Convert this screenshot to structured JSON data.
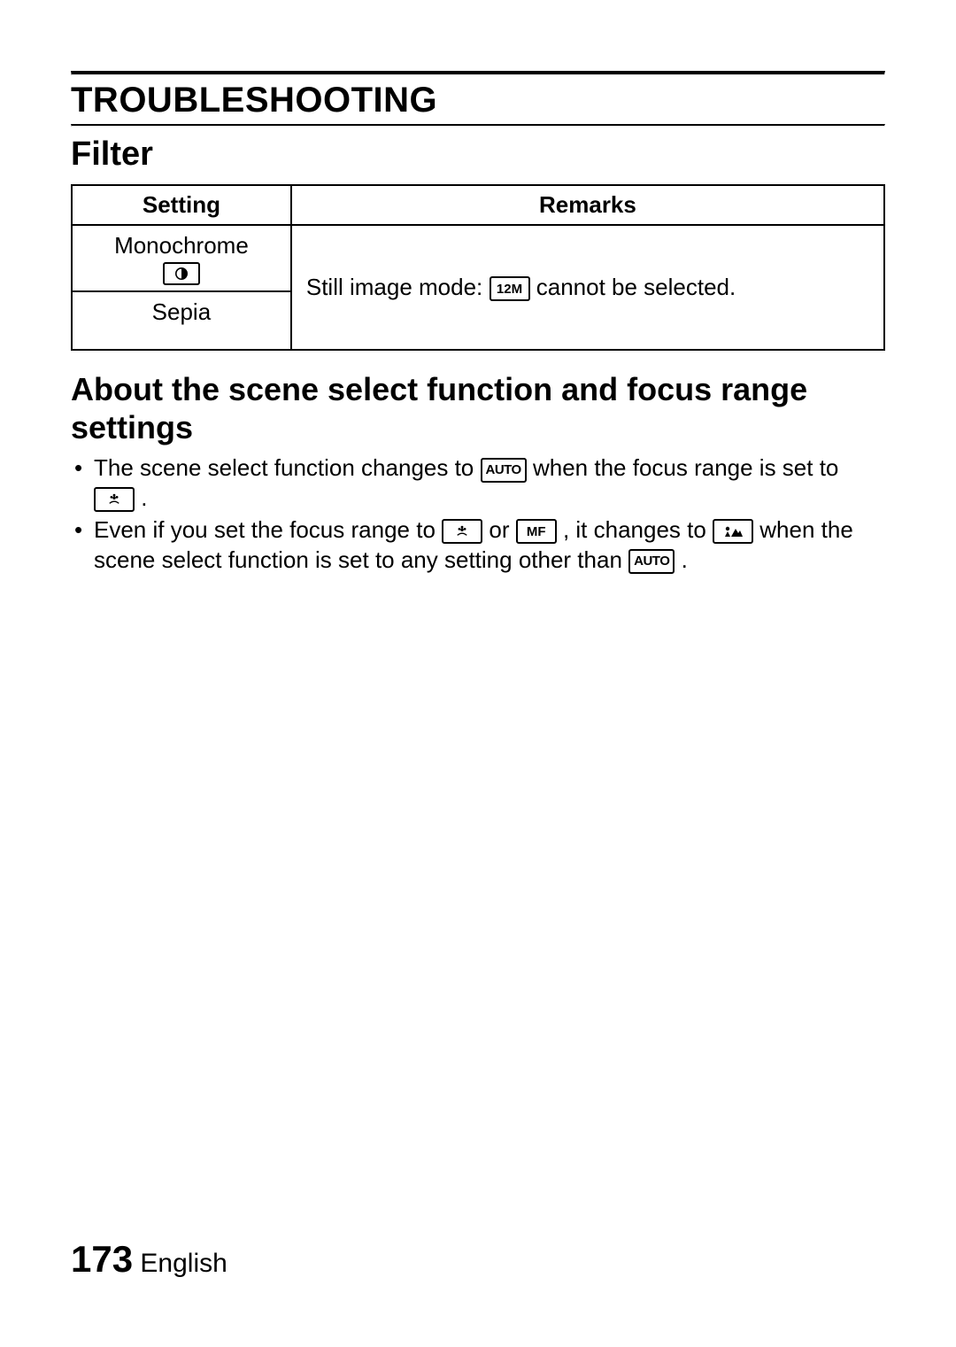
{
  "header": {
    "section_title": "TROUBLESHOOTING",
    "subsection_title": "Filter"
  },
  "table": {
    "col_setting": "Setting",
    "col_remarks": "Remarks",
    "rows": {
      "monochrome": "Monochrome",
      "sepia": "Sepia",
      "remark_prefix": "Still image mode: ",
      "remark_icon": "12M",
      "remark_suffix": " cannot be selected."
    }
  },
  "about": {
    "heading": "About the scene select function and focus range settings",
    "bullet1": {
      "p1": "The scene select function changes to ",
      "icon1": "AUTO",
      "p2": " when the focus range is set to ",
      "p3": "."
    },
    "bullet2": {
      "p1": "Even if you set the focus range to ",
      "p2": " or ",
      "mf": "MF",
      "p3": ", it changes to ",
      "p4": " when the scene select function is set to any setting other than ",
      "auto": "AUTO",
      "p5": "."
    }
  },
  "footer": {
    "page": "173",
    "lang": "English"
  }
}
